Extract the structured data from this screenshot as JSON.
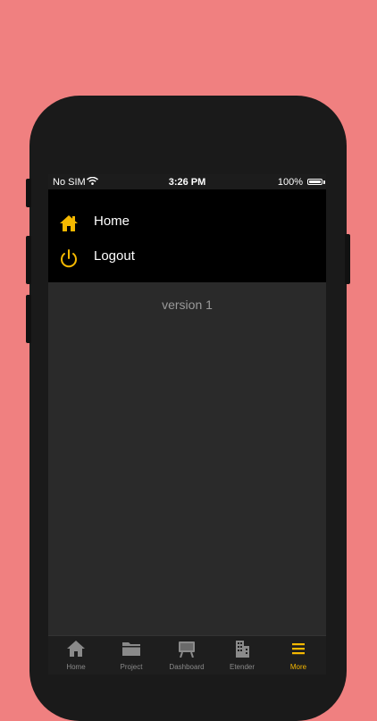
{
  "status_bar": {
    "carrier": "No SIM",
    "time": "3:26 PM",
    "battery": "100%"
  },
  "menu": {
    "items": [
      {
        "label": "Home",
        "icon": "home-icon"
      },
      {
        "label": "Logout",
        "icon": "power-icon"
      }
    ]
  },
  "version_text": "version 1",
  "tab_bar": {
    "tabs": [
      {
        "label": "Home",
        "icon": "home-icon"
      },
      {
        "label": "Project",
        "icon": "folder-icon"
      },
      {
        "label": "Dashboard",
        "icon": "easel-icon"
      },
      {
        "label": "Etender",
        "icon": "building-icon"
      },
      {
        "label": "More",
        "icon": "menu-icon",
        "active": true
      }
    ]
  },
  "colors": {
    "background": "#f08080",
    "accent": "#f5b800",
    "screen": "#2a2a2a",
    "menu": "#000000"
  }
}
